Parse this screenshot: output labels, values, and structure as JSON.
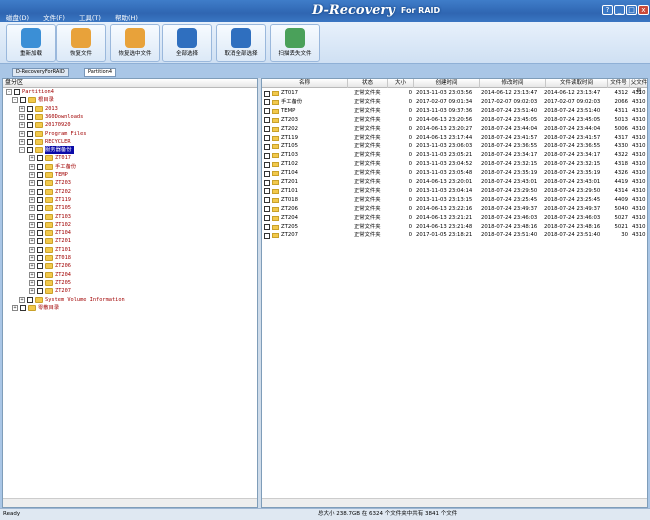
{
  "app": {
    "brand_main": "D-Recovery",
    "brand_sub": "For RAID"
  },
  "menu": [
    "磁盘(D)",
    "文件(F)",
    "工具(T)",
    "帮助(H)"
  ],
  "window_buttons": [
    "?",
    "_",
    "□",
    "x"
  ],
  "toolbar": [
    {
      "label": "重新加载",
      "icon": "reload-icon",
      "color": "#3b8fd6"
    },
    {
      "label": "恢复文件",
      "icon": "recover-file-icon",
      "color": "#e8a23a"
    },
    {
      "label": "恢复选中文件",
      "icon": "recover-selected-icon",
      "color": "#e8a23a"
    },
    {
      "label": "全部选择",
      "icon": "select-all-icon",
      "color": "#2f6fbf"
    },
    {
      "label": "取消全部选择",
      "icon": "deselect-all-icon",
      "color": "#2f6fbf"
    },
    {
      "label": "扫描丢失文件",
      "icon": "scan-lost-icon",
      "color": "#4aa15a"
    }
  ],
  "tabs": [
    "D-RecoveryForRAID",
    "Partition4"
  ],
  "tree": {
    "header": "盘分区",
    "items": [
      {
        "label": "Partition4",
        "level": 0,
        "exp": "-",
        "folder": false
      },
      {
        "label": "根目录",
        "level": 1,
        "exp": "-",
        "folder": true
      },
      {
        "label": "2013",
        "level": 2,
        "exp": "+",
        "folder": true
      },
      {
        "label": "360Downloads",
        "level": 2,
        "exp": "+",
        "folder": true
      },
      {
        "label": "20170920",
        "level": 2,
        "exp": "+",
        "folder": true
      },
      {
        "label": "Program Files",
        "level": 2,
        "exp": "+",
        "folder": true
      },
      {
        "label": "RECYCLER",
        "level": 2,
        "exp": "+",
        "folder": true
      },
      {
        "label": "服务器备份",
        "level": 2,
        "exp": "-",
        "folder": true,
        "selected": true
      },
      {
        "label": "ZT017",
        "level": 3,
        "exp": "+",
        "folder": true
      },
      {
        "label": "手工备份",
        "level": 3,
        "exp": "+",
        "folder": true
      },
      {
        "label": "TEMP",
        "level": 3,
        "exp": "+",
        "folder": true
      },
      {
        "label": "ZT203",
        "level": 3,
        "exp": "+",
        "folder": true
      },
      {
        "label": "ZT202",
        "level": 3,
        "exp": "+",
        "folder": true
      },
      {
        "label": "ZT119",
        "level": 3,
        "exp": "+",
        "folder": true
      },
      {
        "label": "ZT105",
        "level": 3,
        "exp": "+",
        "folder": true
      },
      {
        "label": "ZT103",
        "level": 3,
        "exp": "+",
        "folder": true
      },
      {
        "label": "ZT102",
        "level": 3,
        "exp": "+",
        "folder": true
      },
      {
        "label": "ZT104",
        "level": 3,
        "exp": "+",
        "folder": true
      },
      {
        "label": "ZT201",
        "level": 3,
        "exp": "+",
        "folder": true
      },
      {
        "label": "ZT101",
        "level": 3,
        "exp": "+",
        "folder": true
      },
      {
        "label": "ZT018",
        "level": 3,
        "exp": "+",
        "folder": true
      },
      {
        "label": "ZT206",
        "level": 3,
        "exp": "+",
        "folder": true
      },
      {
        "label": "ZT204",
        "level": 3,
        "exp": "+",
        "folder": true
      },
      {
        "label": "ZT205",
        "level": 3,
        "exp": "+",
        "folder": true
      },
      {
        "label": "ZT207",
        "level": 3,
        "exp": "+",
        "folder": true
      },
      {
        "label": "System Volume Information",
        "level": 2,
        "exp": "+",
        "folder": true
      },
      {
        "label": "零散目录",
        "level": 1,
        "exp": "+",
        "folder": true
      }
    ]
  },
  "table": {
    "columns": [
      "名称",
      "状态",
      "大小",
      "创建时间",
      "修改时间",
      "文件读取时间",
      "文件号",
      "父文件号"
    ],
    "rows": [
      [
        "ZT017",
        "正常文件夹",
        "0",
        "2013-11-03 23:03:56",
        "2014-06-12 23:13:47",
        "2014-06-12 23:13:47",
        "4312",
        "4310"
      ],
      [
        "手工备份",
        "正常文件夹",
        "0",
        "2017-02-07 09:01:34",
        "2017-02-07 09:02:03",
        "2017-02-07 09:02:03",
        "2066",
        "4310"
      ],
      [
        "TEMP",
        "正常文件夹",
        "0",
        "2013-11-03 09:37:36",
        "2018-07-24 23:51:40",
        "2018-07-24 23:51:40",
        "4311",
        "4310"
      ],
      [
        "ZT203",
        "正常文件夹",
        "0",
        "2014-06-13 23:20:56",
        "2018-07-24 23:45:05",
        "2018-07-24 23:45:05",
        "5013",
        "4310"
      ],
      [
        "ZT202",
        "正常文件夹",
        "0",
        "2014-06-13 23:20:27",
        "2018-07-24 23:44:04",
        "2018-07-24 23:44:04",
        "5006",
        "4310"
      ],
      [
        "ZT119",
        "正常文件夹",
        "0",
        "2014-06-13 23:17:44",
        "2018-07-24 23:41:57",
        "2018-07-24 23:41:57",
        "4317",
        "4310"
      ],
      [
        "ZT105",
        "正常文件夹",
        "0",
        "2013-11-03 23:06:03",
        "2018-07-24 23:36:55",
        "2018-07-24 23:36:55",
        "4330",
        "4310"
      ],
      [
        "ZT103",
        "正常文件夹",
        "0",
        "2013-11-03 23:05:21",
        "2018-07-24 23:34:17",
        "2018-07-24 23:34:17",
        "4322",
        "4310"
      ],
      [
        "ZT102",
        "正常文件夹",
        "0",
        "2013-11-03 23:04:52",
        "2018-07-24 23:32:15",
        "2018-07-24 23:32:15",
        "4318",
        "4310"
      ],
      [
        "ZT104",
        "正常文件夹",
        "0",
        "2013-11-03 23:05:48",
        "2018-07-24 23:35:19",
        "2018-07-24 23:35:19",
        "4326",
        "4310"
      ],
      [
        "ZT201",
        "正常文件夹",
        "0",
        "2014-06-13 23:20:01",
        "2018-07-24 23:43:01",
        "2018-07-24 23:43:01",
        "4419",
        "4310"
      ],
      [
        "ZT101",
        "正常文件夹",
        "0",
        "2013-11-03 23:04:14",
        "2018-07-24 23:29:50",
        "2018-07-24 23:29:50",
        "4314",
        "4310"
      ],
      [
        "ZT018",
        "正常文件夹",
        "0",
        "2013-11-03 23:13:15",
        "2018-07-24 23:25:45",
        "2018-07-24 23:25:45",
        "4409",
        "4310"
      ],
      [
        "ZT206",
        "正常文件夹",
        "0",
        "2014-06-13 23:22:16",
        "2018-07-24 23:49:37",
        "2018-07-24 23:49:37",
        "5040",
        "4310"
      ],
      [
        "ZT204",
        "正常文件夹",
        "0",
        "2014-06-13 23:21:21",
        "2018-07-24 23:46:03",
        "2018-07-24 23:46:03",
        "5027",
        "4310"
      ],
      [
        "ZT205",
        "正常文件夹",
        "0",
        "2014-06-13 23:21:48",
        "2018-07-24 23:48:16",
        "2018-07-24 23:48:16",
        "5021",
        "4310"
      ],
      [
        "ZT207",
        "正常文件夹",
        "0",
        "2017-01-05 23:18:21",
        "2018-07-24 23:51:40",
        "2018-07-24 23:51:40",
        "30",
        "4310"
      ]
    ]
  },
  "status": {
    "left": "Ready",
    "main": "总大小 238.7GB 在 6324 个文件夹中共有 3841 个文件"
  }
}
